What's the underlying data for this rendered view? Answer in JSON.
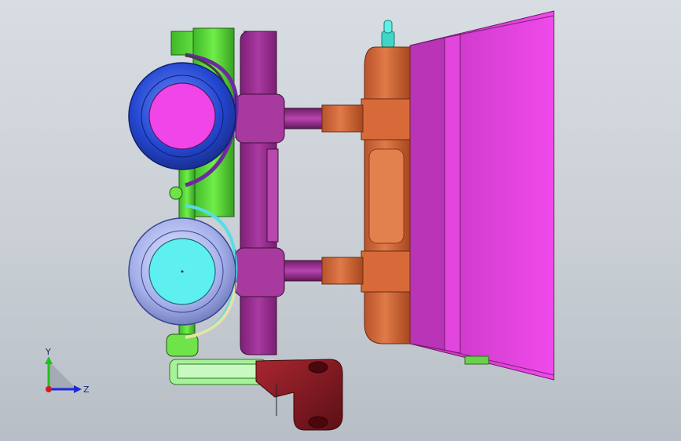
{
  "view": {
    "background_top": "#d7dde2",
    "background_bottom": "#b8bec5"
  },
  "model": {
    "parts": [
      "green-bracket",
      "blue-bearing",
      "lightblue-bearing",
      "purple-plate",
      "orange-block",
      "magenta-plate",
      "darkred-clamp",
      "cyan-pin"
    ],
    "colors": {
      "green": "#5fe03a",
      "green_dark": "#2f8a1e",
      "blue": "#2a4fd8",
      "blue_light": "#5f83f0",
      "magenta": "#ef45e9",
      "magenta_dark": "#b52fb4",
      "lavender": "#a9b4ee",
      "cyan": "#5ef0f0",
      "purple": "#9a2c92",
      "purple_dark": "#6a1a64",
      "orange": "#d8683a",
      "orange_dark": "#9c4522",
      "darkred": "#8a1a22",
      "teal": "#3fd6c8"
    }
  },
  "triad": {
    "y_label": "Y",
    "z_label": "Z",
    "y_color": "#22c01a",
    "z_color": "#1a2ad8",
    "x_color": "#d81a1a"
  }
}
